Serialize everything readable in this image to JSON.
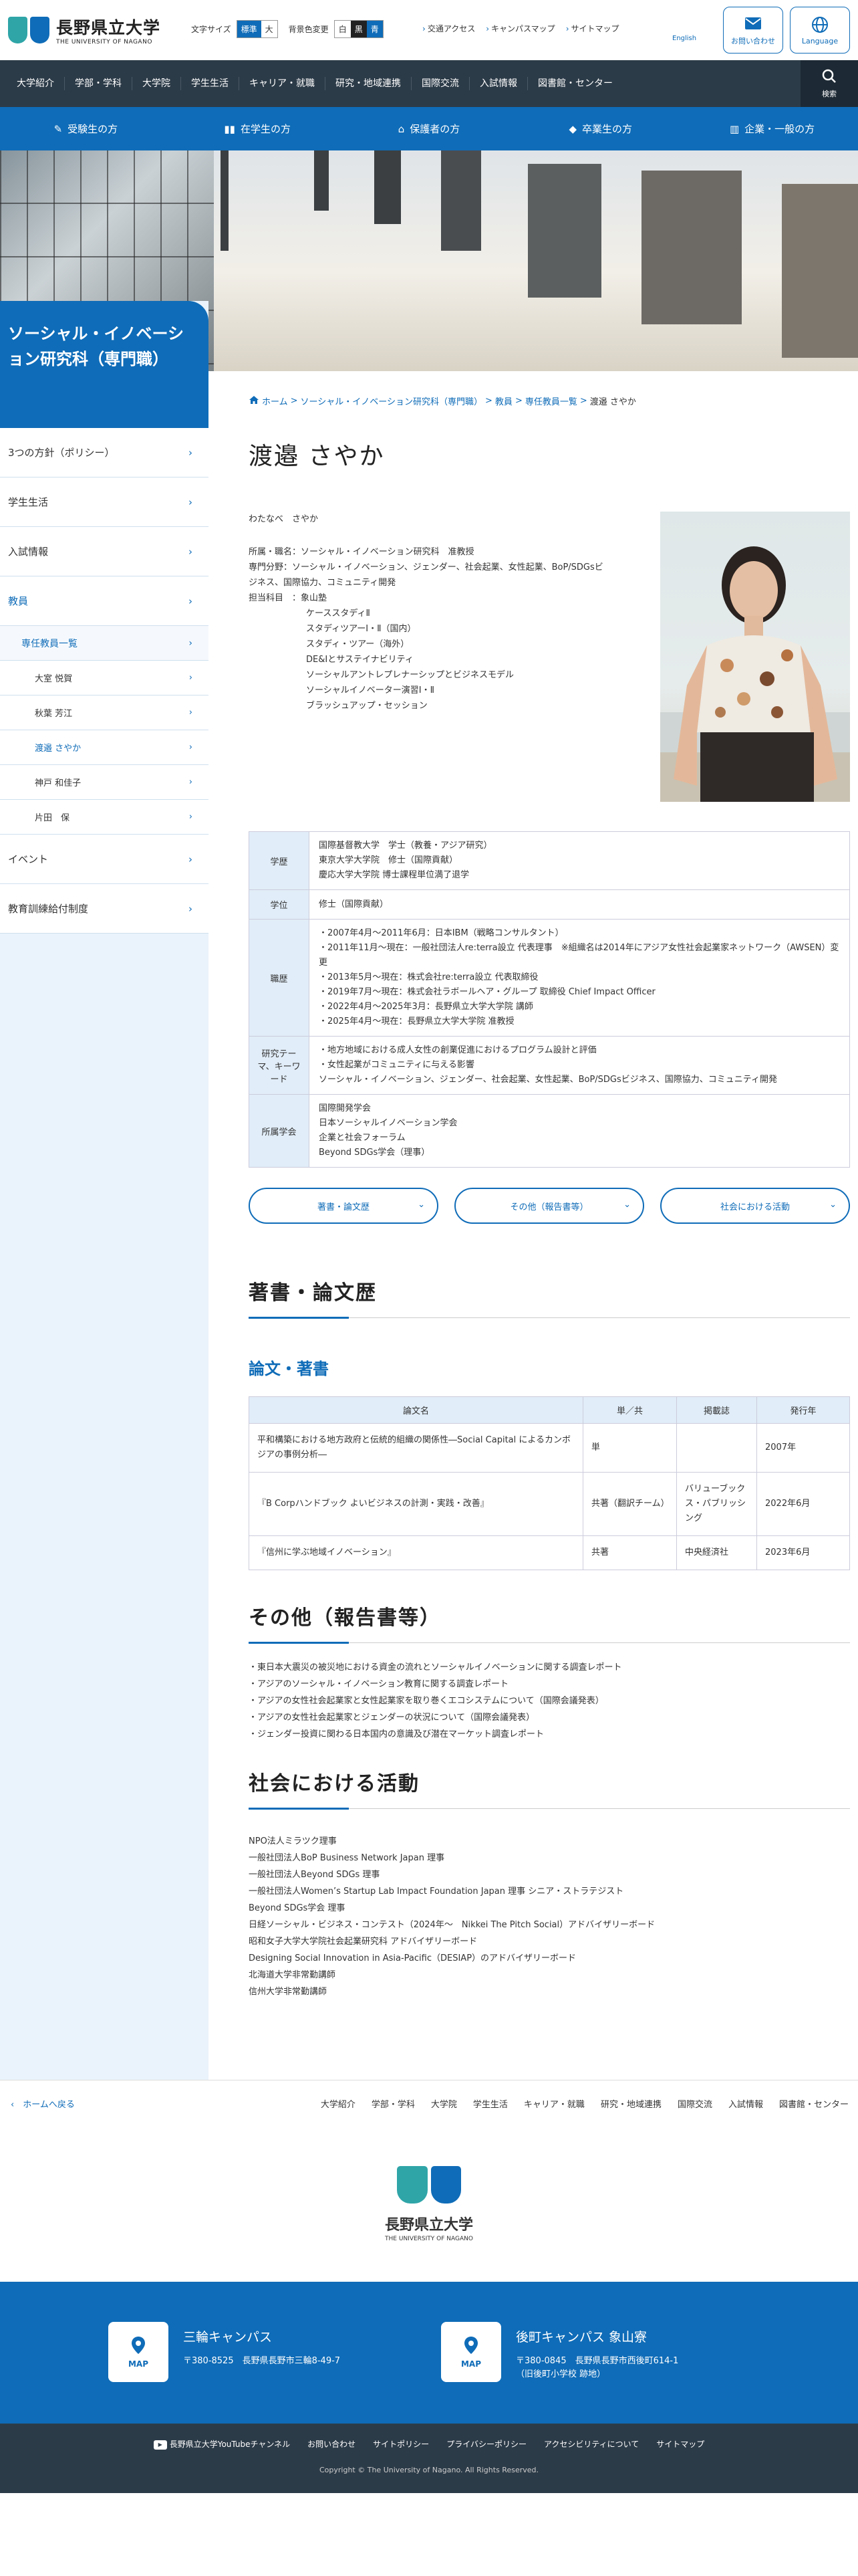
{
  "header": {
    "logo_ja": "長野県立大学",
    "logo_en": "THE UNIVERSITY OF NAGANO",
    "font_size_label": "文字サイズ",
    "font_size_options": [
      "標準",
      "大"
    ],
    "bg_label": "背景色変更",
    "bg_options": [
      "白",
      "黒",
      "青"
    ],
    "links": [
      "交通アクセス",
      "キャンパスマップ",
      "サイトマップ"
    ],
    "small_link": "English",
    "contact_label": "お問い合わせ",
    "language_label": "Language"
  },
  "gnav": {
    "items": [
      "大学紹介",
      "学部・学科",
      "大学院",
      "学生生活",
      "キャリア・就職",
      "研究・地域連携",
      "国際交流",
      "入試情報",
      "図書館・センター"
    ],
    "search_label": "検索"
  },
  "target_nav": [
    "受験生の方",
    "在学生の方",
    "保護者の方",
    "卒業生の方",
    "企業・一般の方"
  ],
  "sidebar": {
    "title": "ソーシャル・イノベーション研究科（専門職）",
    "items": [
      "3つの方針（ポリシー）",
      "学生生活",
      "入試情報",
      "教員"
    ],
    "sub_title": "専任教員一覧",
    "sub_items": [
      "大室 悦賀",
      "秋葉 芳江",
      "渡邉 さやか",
      "神戸 和佳子",
      "片田　保"
    ],
    "after_items": [
      "イベント",
      "教育訓練給付制度"
    ]
  },
  "breadcrumb": [
    "ホーム",
    "ソーシャル・イノベーション研究科（専門職）",
    "教員",
    "専任教員一覧",
    "渡邉 さやか"
  ],
  "person": {
    "name": "渡邉 さやか",
    "kana": "わたなべ　さやか",
    "position": "所属・職名：ソーシャル・イノベーション研究科　准教授",
    "field": "専門分野：ソーシャル・イノベーション、ジェンダー、社会起業、女性起業、BoP/SDGsビジネス、国際協力、コミュニティ開発",
    "courses_label": "担当科目　：象山塾",
    "courses": [
      "ケーススタディⅡ",
      "スタディツアーⅠ・Ⅱ（国内）",
      "スタディ・ツアー（海外）",
      "DE&Iとサステイナビリティ",
      "ソーシャルアントレプレナーシップとビジネスモデル",
      "ソーシャルイノベーター演習Ⅰ・Ⅱ",
      "ブラッシュアップ・セッション"
    ]
  },
  "details": [
    {
      "head": "学歴",
      "lines": [
        "国際基督教大学　学士（教養・アジア研究）",
        "東京大学大学院　修士（国際貢献）",
        "慶応大学大学院 博士課程単位満了退学"
      ]
    },
    {
      "head": "学位",
      "lines": [
        "修士（国際貢献）"
      ]
    },
    {
      "head": "職歴",
      "lines": [
        "・2007年4月〜2011年6月：日本IBM（戦略コンサルタント）",
        "・2011年11月〜現在：一般社団法人re:terra設立 代表理事　※組織名は2014年にアジア女性社会起業家ネットワーク（AWSEN）変更",
        "・2013年5月〜現在：株式会社re:terra設立 代表取締役",
        "・2019年7月〜現在：株式会社ラボールヘア・グループ 取締役 Chief Impact Officer",
        "・2022年4月〜2025年3月：長野県立大学大学院 講師",
        "・2025年4月〜現在：長野県立大学大学院 准教授"
      ]
    },
    {
      "head": "研究テーマ、キーワード",
      "lines": [
        "・地方地域における成人女性の創業促進におけるプログラム設計と評価",
        "・女性起業がコミュニティに与える影響",
        "ソーシャル・イノベーション、ジェンダー、社会起業、女性起業、BoP/SDGsビジネス、国際協力、コミュニティ開発"
      ]
    },
    {
      "head": "所属学会",
      "lines": [
        "国際開発学会",
        "日本ソーシャルイノベーション学会",
        "企業と社会フォーラム",
        "Beyond SDGs学会（理事）"
      ]
    }
  ],
  "anchors": [
    "著書・論文歴",
    "その他（報告書等）",
    "社会における活動"
  ],
  "books": {
    "h2": "著書・論文歴",
    "h3": "論文・著書",
    "headers": [
      "論文名",
      "単／共",
      "掲載誌",
      "発行年"
    ],
    "rows": [
      [
        "平和構築における地方政府と伝統的組織の関係性―Social Capital によるカンボジアの事例分析―",
        "単",
        "",
        "2007年"
      ],
      [
        "『B Corpハンドブック よいビジネスの計測・実践・改善』",
        "共著（翻訳チーム）",
        "バリューブックス・パブリッシング",
        "2022年6月"
      ],
      [
        "『信州に学ぶ地域イノベーション』",
        "共著",
        "中央経済社",
        "2023年6月"
      ]
    ]
  },
  "reports": {
    "h2": "その他（報告書等）",
    "items": [
      "・東日本大震災の被災地における資金の流れとソーシャルイノベーションに関する調査レポート",
      "・アジアのソーシャル・イノベーション教育に関する調査レポート",
      "・アジアの女性社会起業家と女性起業家を取り巻くエコシステムについて（国際会議発表）",
      "・アジアの女性社会起業家とジェンダーの状況について（国際会議発表）",
      "・ジェンダー投資に関わる日本国内の意識及び潜在マーケット調査レポート"
    ]
  },
  "activities": {
    "h2": "社会における活動",
    "items": [
      "NPO法人ミラツク理事",
      "一般社団法人BoP Business Network Japan 理事",
      "一般社団法人Beyond SDGs 理事",
      "一般社団法人Women’s Startup Lab Impact Foundation Japan 理事 シニア・ストラテジスト",
      "Beyond SDGs学会 理事",
      "日経ソーシャル・ビジネス・コンテスト（2024年〜　Nikkei The Pitch Social）アドバイザリーボード",
      "昭和女子大学大学院社会起業研究科 アドバイザリーボード",
      "Designing Social Innovation in Asia-Pacific（DESIAP）のアドバイザリーボード",
      "北海道大学非常勤講師",
      "信州大学非常勤講師"
    ]
  },
  "footer": {
    "home_label": "ホームへ戻る",
    "nav": [
      "大学紹介",
      "学部・学科",
      "大学院",
      "学生生活",
      "キャリア・就職",
      "研究・地域連携",
      "国際交流",
      "入試情報",
      "図書館・センター"
    ],
    "campus": [
      {
        "name": "三輪キャンパス",
        "addr1": "〒380-8525　長野県長野市三輪8-49-7",
        "addr2": ""
      },
      {
        "name": "後町キャンパス 象山寮",
        "addr1": "〒380-0845　長野県長野市西後町614-1",
        "addr2": "（旧後町小学校 跡地）"
      }
    ],
    "map_label": "MAP",
    "bottom_links": [
      "長野県立大学YouTubeチャンネル",
      "お問い合わせ",
      "サイトポリシー",
      "プライバシーポリシー",
      "アクセシビリティについて",
      "サイトマップ"
    ],
    "copyright": "Copyright © The University of Nagano. All Rights Reserved."
  },
  "colors": {
    "primary": "#0f6cb8",
    "nav": "#2c3b48",
    "side_bg": "#eaf3fb",
    "teal": "#2fa5a8"
  }
}
